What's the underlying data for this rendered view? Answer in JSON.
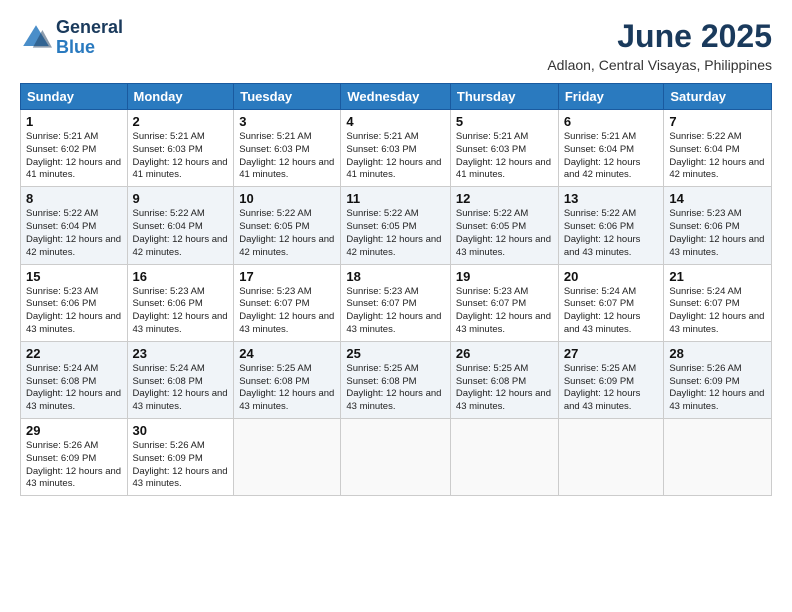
{
  "logo": {
    "line1": "General",
    "line2": "Blue"
  },
  "title": "June 2025",
  "location": "Adlaon, Central Visayas, Philippines",
  "weekdays": [
    "Sunday",
    "Monday",
    "Tuesday",
    "Wednesday",
    "Thursday",
    "Friday",
    "Saturday"
  ],
  "weeks": [
    [
      {
        "day": "1",
        "sunrise": "5:21 AM",
        "sunset": "6:02 PM",
        "daylight": "12 hours and 41 minutes."
      },
      {
        "day": "2",
        "sunrise": "5:21 AM",
        "sunset": "6:03 PM",
        "daylight": "12 hours and 41 minutes."
      },
      {
        "day": "3",
        "sunrise": "5:21 AM",
        "sunset": "6:03 PM",
        "daylight": "12 hours and 41 minutes."
      },
      {
        "day": "4",
        "sunrise": "5:21 AM",
        "sunset": "6:03 PM",
        "daylight": "12 hours and 41 minutes."
      },
      {
        "day": "5",
        "sunrise": "5:21 AM",
        "sunset": "6:03 PM",
        "daylight": "12 hours and 41 minutes."
      },
      {
        "day": "6",
        "sunrise": "5:21 AM",
        "sunset": "6:04 PM",
        "daylight": "12 hours and 42 minutes."
      },
      {
        "day": "7",
        "sunrise": "5:22 AM",
        "sunset": "6:04 PM",
        "daylight": "12 hours and 42 minutes."
      }
    ],
    [
      {
        "day": "8",
        "sunrise": "5:22 AM",
        "sunset": "6:04 PM",
        "daylight": "12 hours and 42 minutes."
      },
      {
        "day": "9",
        "sunrise": "5:22 AM",
        "sunset": "6:04 PM",
        "daylight": "12 hours and 42 minutes."
      },
      {
        "day": "10",
        "sunrise": "5:22 AM",
        "sunset": "6:05 PM",
        "daylight": "12 hours and 42 minutes."
      },
      {
        "day": "11",
        "sunrise": "5:22 AM",
        "sunset": "6:05 PM",
        "daylight": "12 hours and 42 minutes."
      },
      {
        "day": "12",
        "sunrise": "5:22 AM",
        "sunset": "6:05 PM",
        "daylight": "12 hours and 43 minutes."
      },
      {
        "day": "13",
        "sunrise": "5:22 AM",
        "sunset": "6:06 PM",
        "daylight": "12 hours and 43 minutes."
      },
      {
        "day": "14",
        "sunrise": "5:23 AM",
        "sunset": "6:06 PM",
        "daylight": "12 hours and 43 minutes."
      }
    ],
    [
      {
        "day": "15",
        "sunrise": "5:23 AM",
        "sunset": "6:06 PM",
        "daylight": "12 hours and 43 minutes."
      },
      {
        "day": "16",
        "sunrise": "5:23 AM",
        "sunset": "6:06 PM",
        "daylight": "12 hours and 43 minutes."
      },
      {
        "day": "17",
        "sunrise": "5:23 AM",
        "sunset": "6:07 PM",
        "daylight": "12 hours and 43 minutes."
      },
      {
        "day": "18",
        "sunrise": "5:23 AM",
        "sunset": "6:07 PM",
        "daylight": "12 hours and 43 minutes."
      },
      {
        "day": "19",
        "sunrise": "5:23 AM",
        "sunset": "6:07 PM",
        "daylight": "12 hours and 43 minutes."
      },
      {
        "day": "20",
        "sunrise": "5:24 AM",
        "sunset": "6:07 PM",
        "daylight": "12 hours and 43 minutes."
      },
      {
        "day": "21",
        "sunrise": "5:24 AM",
        "sunset": "6:07 PM",
        "daylight": "12 hours and 43 minutes."
      }
    ],
    [
      {
        "day": "22",
        "sunrise": "5:24 AM",
        "sunset": "6:08 PM",
        "daylight": "12 hours and 43 minutes."
      },
      {
        "day": "23",
        "sunrise": "5:24 AM",
        "sunset": "6:08 PM",
        "daylight": "12 hours and 43 minutes."
      },
      {
        "day": "24",
        "sunrise": "5:25 AM",
        "sunset": "6:08 PM",
        "daylight": "12 hours and 43 minutes."
      },
      {
        "day": "25",
        "sunrise": "5:25 AM",
        "sunset": "6:08 PM",
        "daylight": "12 hours and 43 minutes."
      },
      {
        "day": "26",
        "sunrise": "5:25 AM",
        "sunset": "6:08 PM",
        "daylight": "12 hours and 43 minutes."
      },
      {
        "day": "27",
        "sunrise": "5:25 AM",
        "sunset": "6:09 PM",
        "daylight": "12 hours and 43 minutes."
      },
      {
        "day": "28",
        "sunrise": "5:26 AM",
        "sunset": "6:09 PM",
        "daylight": "12 hours and 43 minutes."
      }
    ],
    [
      {
        "day": "29",
        "sunrise": "5:26 AM",
        "sunset": "6:09 PM",
        "daylight": "12 hours and 43 minutes."
      },
      {
        "day": "30",
        "sunrise": "5:26 AM",
        "sunset": "6:09 PM",
        "daylight": "12 hours and 43 minutes."
      },
      null,
      null,
      null,
      null,
      null
    ]
  ]
}
